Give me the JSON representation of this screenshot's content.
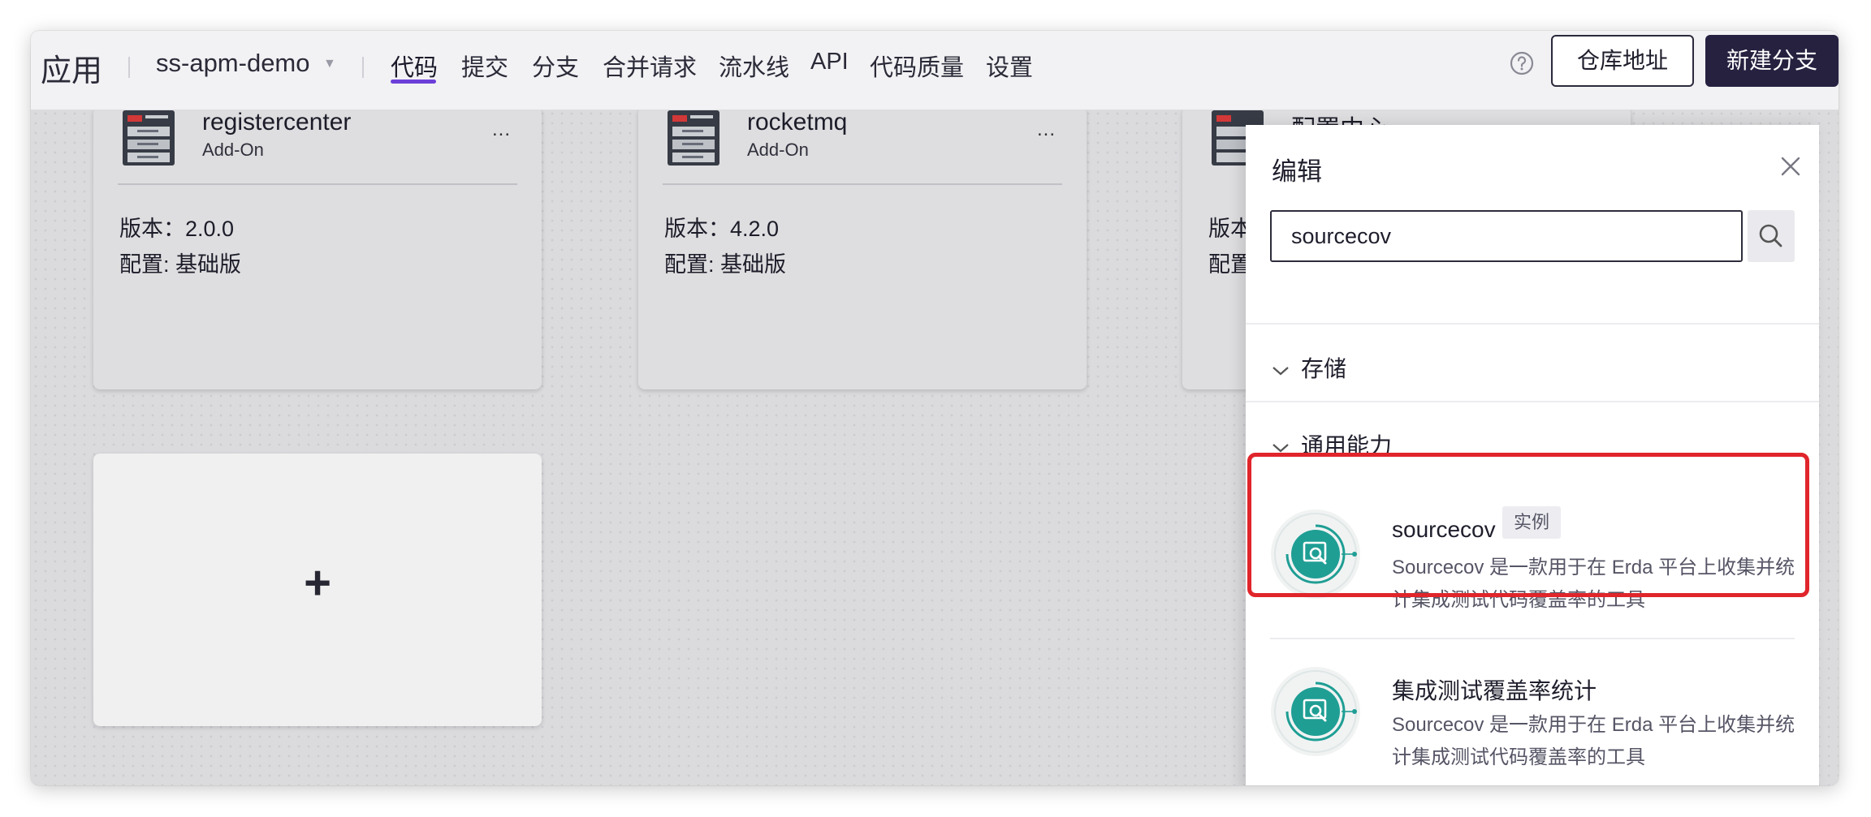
{
  "header": {
    "app_title": "应用",
    "project": "ss-apm-demo",
    "nav": [
      {
        "label": "代码",
        "active": true
      },
      {
        "label": "提交"
      },
      {
        "label": "分支"
      },
      {
        "label": "合并请求"
      },
      {
        "label": "流水线"
      },
      {
        "label": "API"
      },
      {
        "label": "代码质量"
      },
      {
        "label": "设置"
      }
    ],
    "repo_button": "仓库地址",
    "new_branch_button": "新建分支"
  },
  "cards": [
    {
      "name": "registercenter",
      "type": "Add-On",
      "more": "...",
      "version_label": "版本：",
      "version": "2.0.0",
      "config": "配置: 基础版"
    },
    {
      "name": "rocketmq",
      "type": "Add-On",
      "more": "...",
      "version_label": "版本：",
      "version": "4.2.0",
      "config": "配置: 基础版"
    },
    {
      "name": "配置中心",
      "version_label": "版本",
      "config": "配置"
    }
  ],
  "add_card": {
    "plus": "+"
  },
  "drawer": {
    "title": "编辑",
    "search_value": "sourcecov",
    "groups": [
      "存储",
      "通用能力"
    ],
    "items": [
      {
        "name": "sourcecov",
        "tag": "实例",
        "desc": "Sourcecov 是一款用于在 Erda 平台上收集并统计集成测试代码覆盖率的工具",
        "highlighted": true
      },
      {
        "name": "集成测试覆盖率统计",
        "desc": "Sourcecov 是一款用于在 Erda 平台上收集并统计集成测试代码覆盖率的工具"
      }
    ]
  },
  "colors": {
    "accent": "#6d3fd9",
    "primary_button": "#25213f",
    "highlight": "#e0252b",
    "addon_icon": "#1f9e94"
  }
}
